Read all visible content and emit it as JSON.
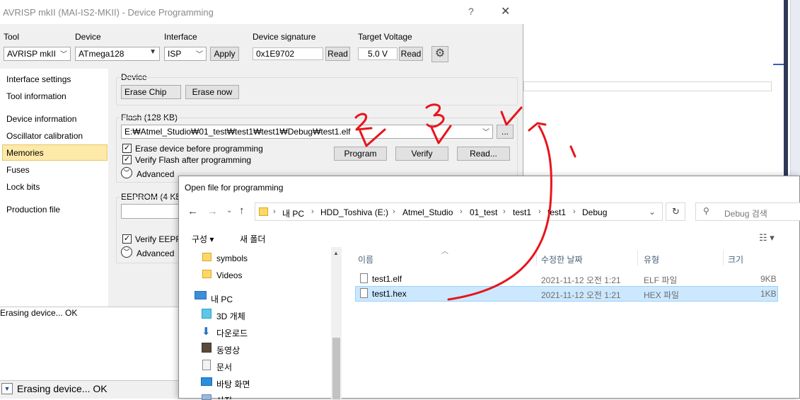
{
  "window": {
    "title": "AVRISP mkII (MAI-IS2-MKII) - Device Programming",
    "help": "?",
    "close": "✕"
  },
  "toolbar": {
    "tool_label": "Tool",
    "tool_value": "AVRISP mkII",
    "device_label": "Device",
    "device_value": "ATmega128",
    "interface_label": "Interface",
    "interface_value": "ISP",
    "apply": "Apply",
    "signature_label": "Device signature",
    "signature_value": "0x1E9702",
    "signature_read": "Read",
    "voltage_label": "Target Voltage",
    "voltage_value": "5.0 V",
    "voltage_read": "Read"
  },
  "nav": {
    "items": [
      "Interface settings",
      "Tool information",
      "Device information",
      "Oscillator calibration",
      "Memories",
      "Fuses",
      "Lock bits",
      "Production file"
    ],
    "selected": "Memories"
  },
  "device_group": {
    "label": "Device",
    "erase_mode": "Erase Chip",
    "erase_now": "Erase now"
  },
  "flash": {
    "label": "Flash (128 KB)",
    "path": "E:₩Atmel_Studio₩01_test₩test1₩test1₩Debug₩test1.elf",
    "browse": "...",
    "erase_before": "Erase device before programming",
    "verify_after": "Verify Flash after programming",
    "advanced": "Advanced",
    "program": "Program",
    "verify": "Verify",
    "read": "Read..."
  },
  "eeprom": {
    "label": "EEPROM (4 KB",
    "verify": "Verify EEPR",
    "advanced": "Advanced"
  },
  "log": {
    "text": "Erasing device... OK",
    "status": "Erasing device... OK"
  },
  "dialog": {
    "title": "Open file for programming",
    "breadcrumbs": [
      "내 PC",
      "HDD_Toshiva (E:)",
      "Atmel_Studio",
      "01_test",
      "test1",
      "test1",
      "Debug"
    ],
    "search_placeholder": "Debug 검색",
    "organize": "구성 ▾",
    "new_folder": "새 폴더",
    "tree": [
      "symbols",
      "Videos",
      "내 PC",
      "3D 개체",
      "다운로드",
      "동영상",
      "문서",
      "바탕 화면",
      "사진"
    ],
    "columns": [
      "이름",
      "수정한 날짜",
      "유형",
      "크기"
    ],
    "files": [
      {
        "name": "test1.elf",
        "date": "2021-11-12 오전 1:21",
        "type": "ELF 파일",
        "size": "9KB"
      },
      {
        "name": "test1.hex",
        "date": "2021-11-12 오전 1:21",
        "type": "HEX 파일",
        "size": "1KB"
      }
    ]
  },
  "annotations": {
    "one": "1",
    "two": "2",
    "three": "3",
    "color": "#e8141c"
  }
}
